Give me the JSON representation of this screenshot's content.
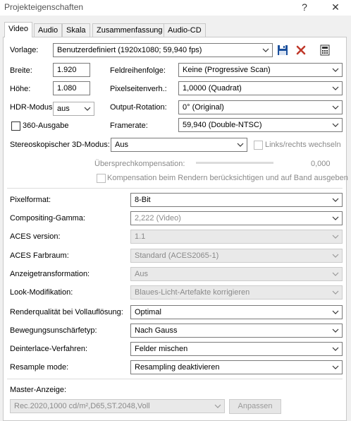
{
  "window": {
    "title": "Projekteigenschaften",
    "help_glyph": "?",
    "close_glyph": "✕"
  },
  "tabs": [
    "Video",
    "Audio",
    "Skala",
    "Zusammenfassung",
    "Audio-CD"
  ],
  "vorlage": {
    "label": "Vorlage:",
    "value": "Benutzerdefiniert (1920x1080; 59,940 fps)",
    "save_icon": "save-icon",
    "delete_icon": "delete-icon",
    "info_icon": "info-icon"
  },
  "breite": {
    "label": "Breite:",
    "value": "1.920"
  },
  "hoehe": {
    "label": "Höhe:",
    "value": "1.080"
  },
  "hdr": {
    "label": "HDR-Modus:",
    "value": "aus"
  },
  "ausgabe360": {
    "label": "360-Ausgabe",
    "checked": false
  },
  "feldreihenfolge": {
    "label": "Feldreihenfolge:",
    "value": "Keine (Progressive Scan)"
  },
  "pixelseitenverh": {
    "label": "Pixelseitenverh.:",
    "value": "1,0000 (Quadrat)"
  },
  "output_rotation": {
    "label": "Output-Rotation:",
    "value": "0° (Original)"
  },
  "framerate": {
    "label": "Framerate:",
    "value": "59,940 (Double-NTSC)"
  },
  "stereo": {
    "label": "Stereoskopischer 3D-Modus:",
    "value": "Aus",
    "swap_label": "Links/rechts wechseln"
  },
  "uebersprech": {
    "label": "Übersprechkompensation:",
    "value": "0,000"
  },
  "kompensation": {
    "label": "Kompensation beim Rendern berücksichtigen und auf Band ausgeben"
  },
  "pixelformat": {
    "label": "Pixelformat:",
    "value": "8-Bit"
  },
  "compositing_gamma": {
    "label": "Compositing-Gamma:",
    "value": "2,222 (Video)"
  },
  "aces_version": {
    "label": "ACES version:",
    "value": "1.1"
  },
  "aces_farbraum": {
    "label": "ACES Farbraum:",
    "value": "Standard (ACES2065-1)"
  },
  "anzeigetransformation": {
    "label": "Anzeigetransformation:",
    "value": "Aus"
  },
  "look_modifikation": {
    "label": "Look-Modifikation:",
    "value": "Blaues-Licht-Artefakte korrigieren"
  },
  "renderqualitaet": {
    "label": "Renderqualität bei Vollauflösung:",
    "value": "Optimal"
  },
  "bewegungsunschaerfe": {
    "label": "Bewegungsunschärfetyp:",
    "value": "Nach Gauss"
  },
  "deinterlace": {
    "label": "Deinterlace-Verfahren:",
    "value": "Felder mischen"
  },
  "resample": {
    "label": "Resample mode:",
    "value": "Resampling deaktivieren"
  },
  "master_anzeige": {
    "label": "Master-Anzeige:",
    "value": "Rec.2020,1000 cd/m²,D65,ST.2048,Voll",
    "button": "Anpassen"
  },
  "colors": {
    "window_bg": "#f0f0f0",
    "panel_bg": "#ffffff",
    "save_blue": "#1a4f9c",
    "delete_red": "#c0392b"
  }
}
